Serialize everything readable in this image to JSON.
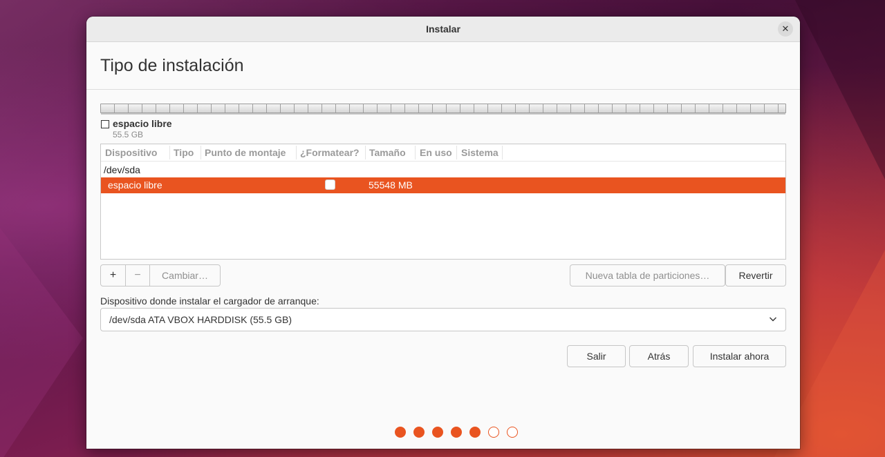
{
  "window": {
    "title": "Instalar",
    "close_icon": "close-icon"
  },
  "page": {
    "title": "Tipo de instalación"
  },
  "disk_legend": {
    "label": "espacio libre",
    "size": "55.5 GB"
  },
  "partition_table": {
    "columns": [
      "Dispositivo",
      "Tipo",
      "Punto de montaje",
      "¿Formatear?",
      "Tamaño",
      "En uso",
      "Sistema"
    ],
    "device": "/dev/sda",
    "rows": [
      {
        "device": "espacio libre",
        "type": "",
        "mount_point": "",
        "format": false,
        "size": "55548 MB",
        "used": "",
        "system": "",
        "selected": true
      }
    ]
  },
  "partition_buttons": {
    "add": "+",
    "remove": "−",
    "change": "Cambiar…",
    "new_table": "Nueva tabla de particiones…",
    "revert": "Revertir"
  },
  "bootloader": {
    "label": "Dispositivo donde instalar el cargador de arranque:",
    "selected": "/dev/sda ATA VBOX HARDDISK (55.5 GB)"
  },
  "actions": {
    "quit": "Salir",
    "back": "Atrás",
    "install": "Instalar ahora"
  },
  "progress": {
    "total_steps": 7,
    "completed_steps": 5
  },
  "colors": {
    "accent": "#e95420"
  }
}
